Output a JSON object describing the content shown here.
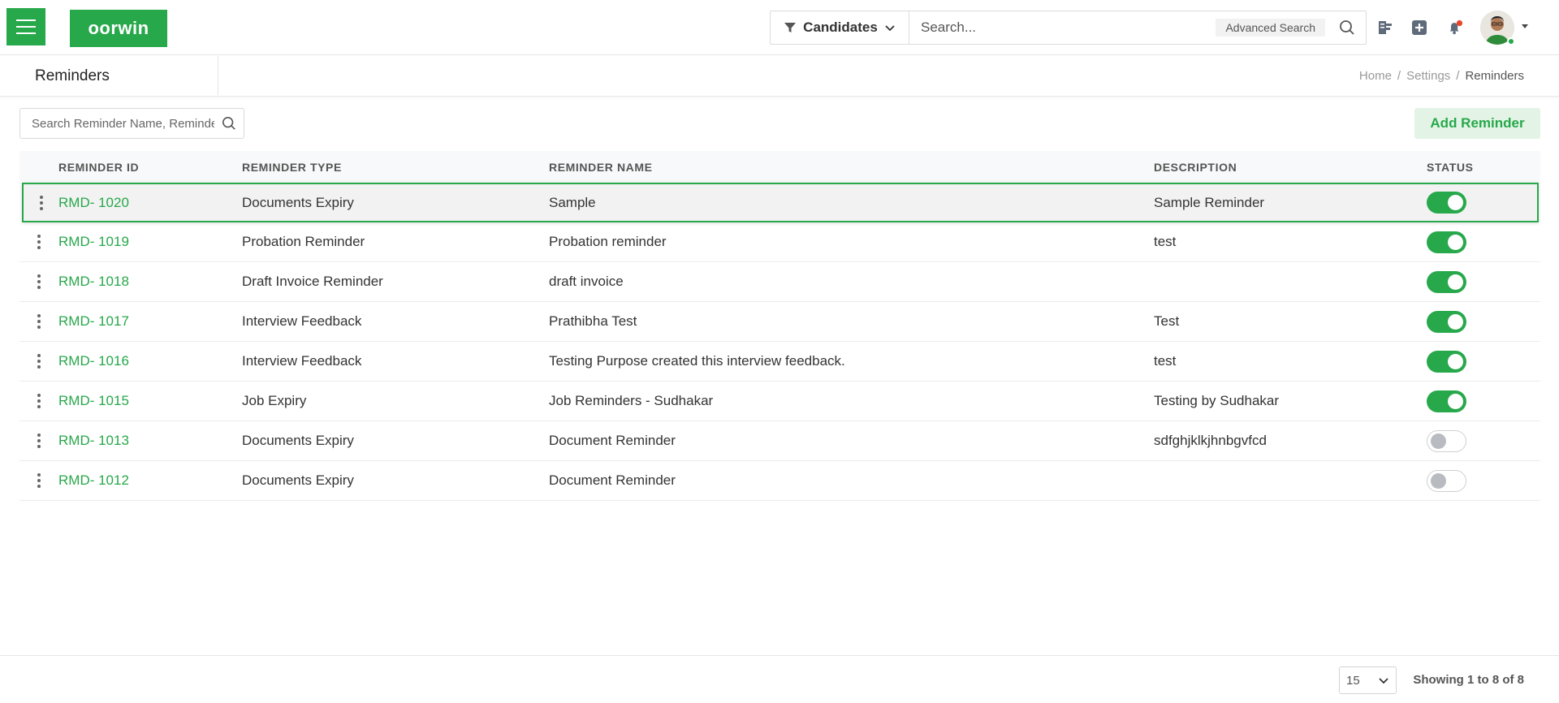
{
  "app": {
    "logo_text": "oorwin",
    "brand_color": "#27a84a"
  },
  "topbar": {
    "module_select": "Candidates",
    "search_placeholder": "Search...",
    "advanced_search": "Advanced Search"
  },
  "header": {
    "title": "Reminders",
    "breadcrumb": {
      "home": "Home",
      "settings": "Settings",
      "current": "Reminders"
    }
  },
  "toolbar": {
    "filter_placeholder": "Search Reminder Name, Reminder Type",
    "add_button": "Add Reminder"
  },
  "table": {
    "columns": {
      "id": "REMINDER ID",
      "type": "REMINDER TYPE",
      "name": "REMINDER NAME",
      "description": "DESCRIPTION",
      "status": "STATUS"
    },
    "rows": [
      {
        "id": "RMD- 1020",
        "type": "Documents Expiry",
        "name": "Sample",
        "description": "Sample Reminder",
        "active": true
      },
      {
        "id": "RMD- 1019",
        "type": "Probation Reminder",
        "name": "Probation reminder",
        "description": "test",
        "active": true
      },
      {
        "id": "RMD- 1018",
        "type": "Draft Invoice Reminder",
        "name": "draft invoice",
        "description": "",
        "active": true
      },
      {
        "id": "RMD- 1017",
        "type": "Interview Feedback",
        "name": "Prathibha Test",
        "description": "Test",
        "active": true
      },
      {
        "id": "RMD- 1016",
        "type": "Interview Feedback",
        "name": "Testing Purpose created this interview feedback.",
        "description": "test",
        "active": true
      },
      {
        "id": "RMD- 1015",
        "type": "Job Expiry",
        "name": "Job Reminders - Sudhakar",
        "description": "Testing by Sudhakar",
        "active": true
      },
      {
        "id": "RMD- 1013",
        "type": "Documents Expiry",
        "name": "Document Reminder",
        "description": "sdfghjklkjhnbgvfcd",
        "active": false
      },
      {
        "id": "RMD- 1012",
        "type": "Documents Expiry",
        "name": "Document Reminder",
        "description": "",
        "active": false
      }
    ]
  },
  "footer": {
    "page_size": "15",
    "showing": "Showing 1 to 8 of 8"
  }
}
